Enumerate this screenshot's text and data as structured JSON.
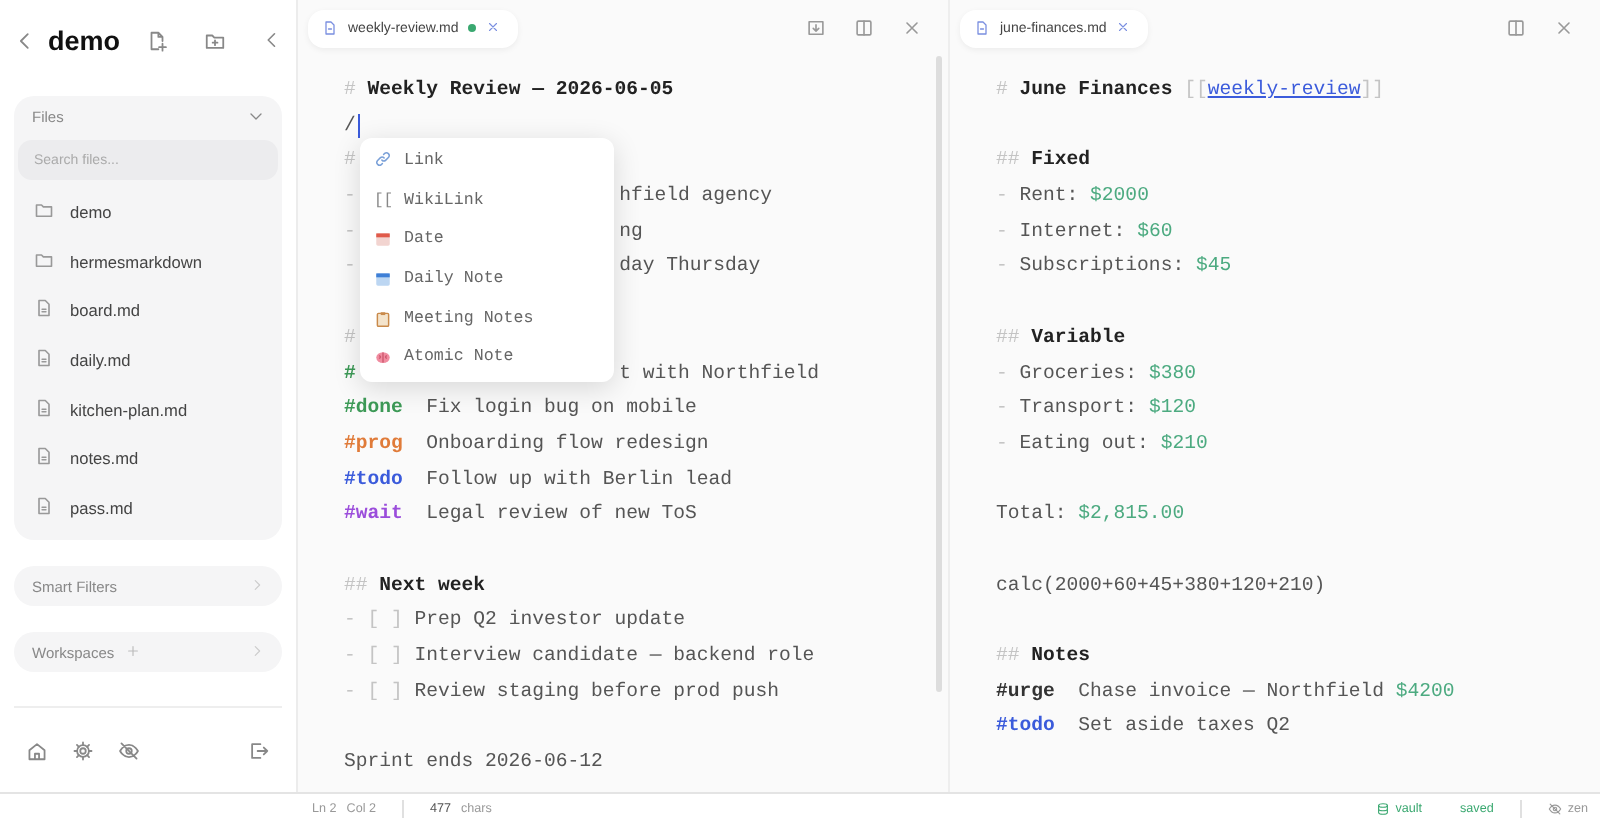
{
  "sidebar": {
    "title": "demo",
    "files": {
      "title": "Files",
      "search": {
        "placeholder": "Search files..."
      },
      "items": [
        {
          "name": "demo",
          "kind": "folder"
        },
        {
          "name": "hermesmarkdown",
          "kind": "folder"
        },
        {
          "name": "board.md",
          "kind": "file"
        },
        {
          "name": "daily.md",
          "kind": "file"
        },
        {
          "name": "kitchen-plan.md",
          "kind": "file"
        },
        {
          "name": "notes.md",
          "kind": "file"
        },
        {
          "name": "pass.md",
          "kind": "file"
        }
      ]
    },
    "sections": [
      {
        "title": "Smart Filters",
        "kind": "plain"
      },
      {
        "title": "Workspaces",
        "kind": "addable"
      }
    ]
  },
  "panes": [
    {
      "tab": {
        "title": "weekly-review.md",
        "modified": true
      },
      "lines": [
        {
          "kind": "text",
          "segments": [
            {
              "kind": "mark",
              "text": "# "
            },
            {
              "kind": "heading",
              "text": "Weekly Review — 2026-06-05"
            }
          ]
        },
        {
          "kind": "text",
          "segments": [
            {
              "kind": "text",
              "text": "/"
            }
          ],
          "cursor": true
        },
        {
          "kind": "text",
          "segments": [
            {
              "kind": "mark",
              "text": "#"
            }
          ]
        },
        {
          "kind": "text",
          "segments": [
            {
              "kind": "mark",
              "text": "-"
            }
          ],
          "tail": "hfield agency"
        },
        {
          "kind": "text",
          "segments": [
            {
              "kind": "mark",
              "text": "-"
            }
          ],
          "tail": "ng"
        },
        {
          "kind": "text",
          "segments": [
            {
              "kind": "mark",
              "text": "-"
            }
          ],
          "tail": "day Thursday"
        },
        {
          "kind": "blank"
        },
        {
          "kind": "text",
          "segments": [
            {
              "kind": "mark",
              "text": "#"
            }
          ]
        },
        {
          "kind": "text",
          "segments": [
            {
              "kind": "tag",
              "text": "#",
              "color": "#3d9a57"
            }
          ],
          "tail": "t with Northfield"
        },
        {
          "kind": "text",
          "segments": [
            {
              "kind": "tag",
              "text": "#done",
              "color": "#3d9a57"
            },
            {
              "kind": "text",
              "text": "Fix login bug on mobile"
            }
          ]
        },
        {
          "kind": "text",
          "segments": [
            {
              "kind": "tag",
              "text": "#prog",
              "color": "#e07b39"
            },
            {
              "kind": "text",
              "text": "Onboarding flow redesign"
            }
          ]
        },
        {
          "kind": "text",
          "segments": [
            {
              "kind": "tag",
              "text": "#todo",
              "color": "#3b5bdb"
            },
            {
              "kind": "text",
              "text": "Follow up with Berlin lead"
            }
          ]
        },
        {
          "kind": "text",
          "segments": [
            {
              "kind": "tag",
              "text": "#wait",
              "color": "#9b4ddb"
            },
            {
              "kind": "text",
              "text": "Legal review of new ToS"
            }
          ]
        },
        {
          "kind": "blank"
        },
        {
          "kind": "text",
          "segments": [
            {
              "kind": "mark",
              "text": "## "
            },
            {
              "kind": "heading",
              "text": "Next week"
            }
          ]
        },
        {
          "kind": "text",
          "segments": [
            {
              "kind": "mark",
              "text": "- [ ] "
            },
            {
              "kind": "text",
              "text": "Prep Q2 investor update"
            }
          ]
        },
        {
          "kind": "text",
          "segments": [
            {
              "kind": "mark",
              "text": "- [ ] "
            },
            {
              "kind": "text",
              "text": "Interview candidate — backend role"
            }
          ]
        },
        {
          "kind": "text",
          "segments": [
            {
              "kind": "mark",
              "text": "- [ ] "
            },
            {
              "kind": "text",
              "text": "Review staging before prod push"
            }
          ]
        },
        {
          "kind": "blank"
        },
        {
          "kind": "text",
          "segments": [
            {
              "kind": "text",
              "text": "Sprint ends 2026-06-12"
            }
          ]
        }
      ],
      "menu": [
        {
          "label": "Link",
          "kind": "link"
        },
        {
          "label": "WikiLink",
          "kind": "wikilink",
          "glyph": "[["
        },
        {
          "label": "Date",
          "kind": "date"
        },
        {
          "label": "Daily Note",
          "kind": "daily"
        },
        {
          "label": "Meeting Notes",
          "kind": "meeting"
        },
        {
          "label": "Atomic Note",
          "kind": "atomic"
        }
      ]
    },
    {
      "tab": {
        "title": "june-finances.md",
        "modified": false
      },
      "lines": [
        {
          "kind": "text",
          "segments": [
            {
              "kind": "mark",
              "text": "# "
            },
            {
              "kind": "heading",
              "text": "June Finances "
            },
            {
              "kind": "mark",
              "text": "[["
            },
            {
              "kind": "link",
              "text": "weekly-review"
            },
            {
              "kind": "mark",
              "text": "]]"
            }
          ]
        },
        {
          "kind": "blank"
        },
        {
          "kind": "text",
          "segments": [
            {
              "kind": "mark",
              "text": "## "
            },
            {
              "kind": "heading",
              "text": "Fixed"
            }
          ]
        },
        {
          "kind": "text",
          "segments": [
            {
              "kind": "mark",
              "text": "- "
            },
            {
              "kind": "text",
              "text": "Rent: "
            },
            {
              "kind": "money",
              "text": "$2000"
            }
          ]
        },
        {
          "kind": "text",
          "segments": [
            {
              "kind": "mark",
              "text": "- "
            },
            {
              "kind": "text",
              "text": "Internet: "
            },
            {
              "kind": "money",
              "text": "$60"
            }
          ]
        },
        {
          "kind": "text",
          "segments": [
            {
              "kind": "mark",
              "text": "- "
            },
            {
              "kind": "text",
              "text": "Subscriptions: "
            },
            {
              "kind": "money",
              "text": "$45"
            }
          ]
        },
        {
          "kind": "blank"
        },
        {
          "kind": "text",
          "segments": [
            {
              "kind": "mark",
              "text": "## "
            },
            {
              "kind": "heading",
              "text": "Variable"
            }
          ]
        },
        {
          "kind": "text",
          "segments": [
            {
              "kind": "mark",
              "text": "- "
            },
            {
              "kind": "text",
              "text": "Groceries: "
            },
            {
              "kind": "money",
              "text": "$380"
            }
          ]
        },
        {
          "kind": "text",
          "segments": [
            {
              "kind": "mark",
              "text": "- "
            },
            {
              "kind": "text",
              "text": "Transport: "
            },
            {
              "kind": "money",
              "text": "$120"
            }
          ]
        },
        {
          "kind": "text",
          "segments": [
            {
              "kind": "mark",
              "text": "- "
            },
            {
              "kind": "text",
              "text": "Eating out: "
            },
            {
              "kind": "money",
              "text": "$210"
            }
          ]
        },
        {
          "kind": "blank"
        },
        {
          "kind": "text",
          "segments": [
            {
              "kind": "text",
              "text": "Total: "
            },
            {
              "kind": "money",
              "text": "$2,815.00"
            }
          ]
        },
        {
          "kind": "blank"
        },
        {
          "kind": "text",
          "segments": [
            {
              "kind": "text",
              "text": "calc(2000+60+45+380+120+210)"
            }
          ]
        },
        {
          "kind": "blank"
        },
        {
          "kind": "text",
          "segments": [
            {
              "kind": "mark",
              "text": "## "
            },
            {
              "kind": "heading",
              "text": "Notes"
            }
          ]
        },
        {
          "kind": "text",
          "segments": [
            {
              "kind": "tag",
              "text": "#urge",
              "color": "#333333"
            },
            {
              "kind": "text",
              "text": "Chase invoice — Northfield "
            },
            {
              "kind": "money",
              "text": "$4200"
            }
          ]
        },
        {
          "kind": "text",
          "segments": [
            {
              "kind": "tag",
              "text": "#todo",
              "color": "#3b5bdb"
            },
            {
              "kind": "text",
              "text": "Set aside taxes Q2"
            }
          ]
        }
      ]
    }
  ],
  "status_bar": {
    "line": "Ln 2",
    "column": "Col 2",
    "count": "477",
    "count_unit": "chars",
    "vault": "vault",
    "saved": "saved",
    "zen": "zen"
  }
}
